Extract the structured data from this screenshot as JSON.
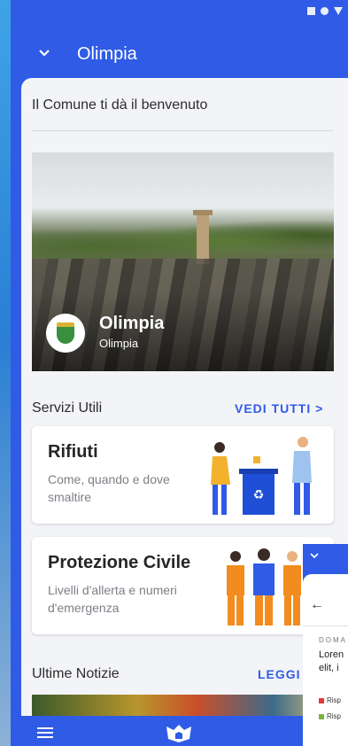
{
  "app": {
    "title": "Olimpia",
    "welcome": "Il Comune ti dà il benvenuto"
  },
  "hero": {
    "title": "Olimpia",
    "subtitle": "Olimpia"
  },
  "services": {
    "heading": "Servizi Utili",
    "link": "VEDI TUTTI >",
    "cards": [
      {
        "title": "Rifiuti",
        "description": "Come, quando e dove smaltire"
      },
      {
        "title": "Protezione Civile",
        "description": "Livelli d'allerta e numeri d'emergenza"
      }
    ]
  },
  "news": {
    "heading": "Ultime Notizie",
    "link": "LEGGI TUTT"
  },
  "overlay": {
    "back": "←",
    "category": "DOMA",
    "lorem_line1": "Loren",
    "lorem_line2": "elit, i",
    "legend": [
      {
        "label": "Risp",
        "color": "#e53935"
      },
      {
        "label": "Risp",
        "color": "#7cb342"
      }
    ]
  },
  "colors": {
    "primary": "#2f5be6",
    "background": "#f3f4f7"
  },
  "icons": [
    "chevron-down-icon",
    "menu-icon",
    "app-logo-icon",
    "arrow-back-icon"
  ]
}
